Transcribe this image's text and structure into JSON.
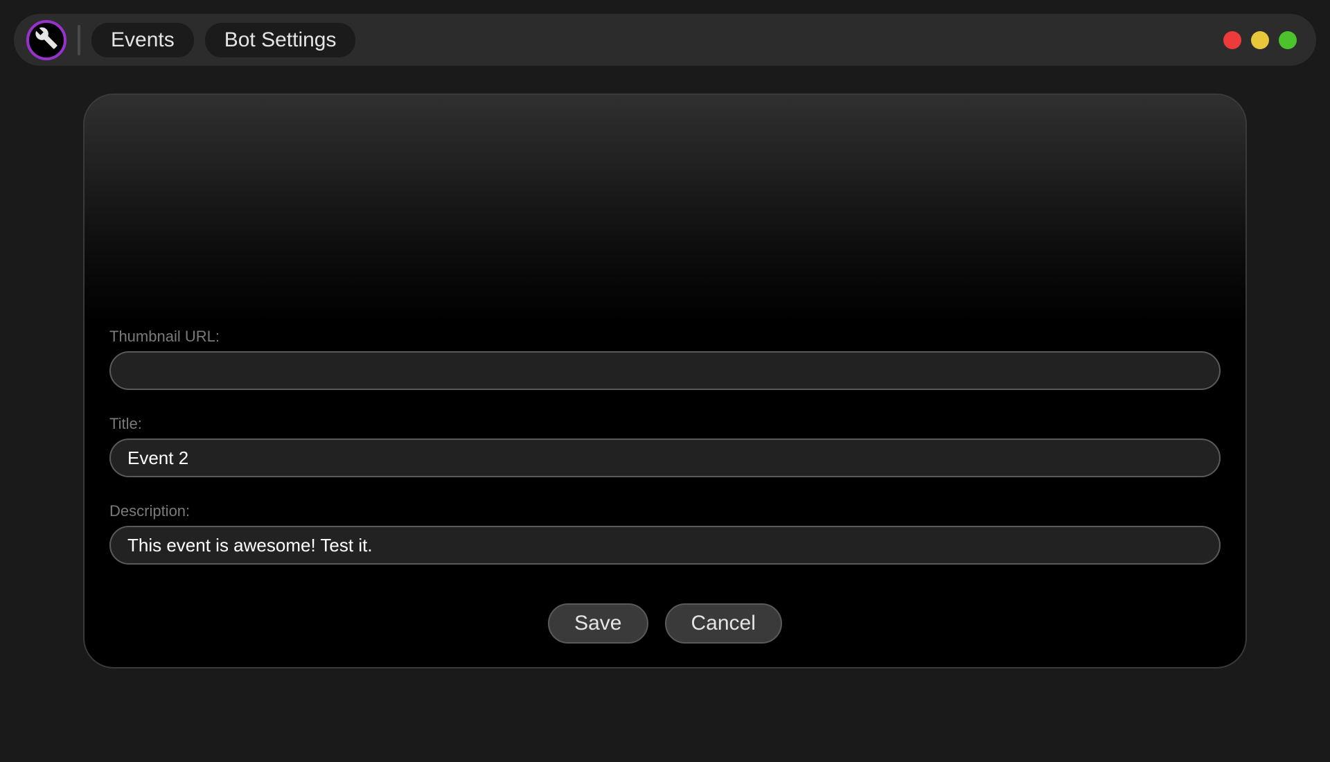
{
  "nav": {
    "tabs": [
      {
        "label": "Events"
      },
      {
        "label": "Bot Settings"
      }
    ]
  },
  "traffic": {
    "red": "#ed3b3b",
    "yellow": "#e8c83a",
    "green": "#4cc22d"
  },
  "form": {
    "thumbnail": {
      "label": "Thumbnail URL:",
      "value": ""
    },
    "title": {
      "label": "Title:",
      "value": "Event 2"
    },
    "description": {
      "label": "Description:",
      "value": "This event is awesome! Test it."
    }
  },
  "actions": {
    "save": "Save",
    "cancel": "Cancel"
  }
}
